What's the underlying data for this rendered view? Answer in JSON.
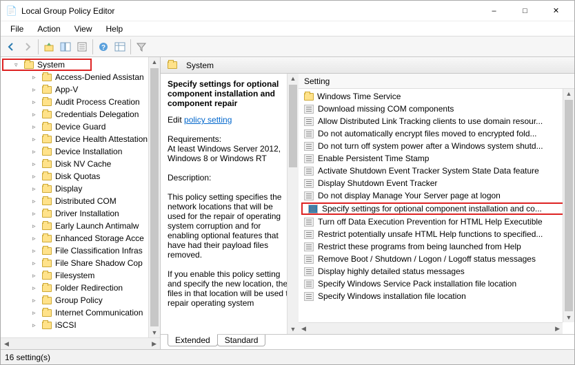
{
  "window": {
    "title": "Local Group Policy Editor"
  },
  "menu": {
    "file": "File",
    "action": "Action",
    "view": "View",
    "help": "Help"
  },
  "tree": {
    "root": "System",
    "items": [
      "Access-Denied Assistan",
      "App-V",
      "Audit Process Creation",
      "Credentials Delegation",
      "Device Guard",
      "Device Health Attestation",
      "Device Installation",
      "Disk NV Cache",
      "Disk Quotas",
      "Display",
      "Distributed COM",
      "Driver Installation",
      "Early Launch Antimalw",
      "Enhanced Storage Acce",
      "File Classification Infras",
      "File Share Shadow Cop",
      "Filesystem",
      "Folder Redirection",
      "Group Policy",
      "Internet Communication",
      "iSCSI"
    ]
  },
  "right": {
    "header": "System",
    "desc": {
      "title": "Specify settings for optional component installation and component repair",
      "edit_label": "Edit",
      "edit_link": "policy setting",
      "req_label": "Requirements:",
      "req_text": "At least Windows Server 2012, Windows 8 or Windows RT",
      "desc_label": "Description:",
      "desc_p1": "This policy setting specifies the network locations that will be used for the repair of operating system corruption and for enabling optional features that have had their payload files removed.",
      "desc_p2": "If you enable this policy setting and specify the new location, the files in that location will be used to repair operating system"
    },
    "list_header": "Setting",
    "settings": [
      {
        "type": "folder",
        "label": "Windows Time Service"
      },
      {
        "type": "setting",
        "label": "Download missing COM components"
      },
      {
        "type": "setting",
        "label": "Allow Distributed Link Tracking clients to use domain resour..."
      },
      {
        "type": "setting",
        "label": "Do not automatically encrypt files moved to encrypted fold..."
      },
      {
        "type": "setting",
        "label": "Do not turn off system power after a Windows system shutd..."
      },
      {
        "type": "setting",
        "label": "Enable Persistent Time Stamp"
      },
      {
        "type": "setting",
        "label": "Activate Shutdown Event Tracker System State Data feature"
      },
      {
        "type": "setting",
        "label": "Display Shutdown Event Tracker"
      },
      {
        "type": "setting",
        "label": "Do not display Manage Your Server page at logon"
      },
      {
        "type": "setting",
        "label": "Specify settings for optional component installation and co...",
        "highlight": true
      },
      {
        "type": "setting",
        "label": "Turn off Data Execution Prevention for HTML Help Executible"
      },
      {
        "type": "setting",
        "label": "Restrict potentially unsafe HTML Help functions to specified..."
      },
      {
        "type": "setting",
        "label": "Restrict these programs from being launched from Help"
      },
      {
        "type": "setting",
        "label": "Remove Boot / Shutdown / Logon / Logoff status messages"
      },
      {
        "type": "setting",
        "label": "Display highly detailed status messages"
      },
      {
        "type": "setting",
        "label": "Specify Windows Service Pack installation file location"
      },
      {
        "type": "setting",
        "label": "Specify Windows installation file location"
      }
    ]
  },
  "tabs": {
    "extended": "Extended",
    "standard": "Standard"
  },
  "status": "16 setting(s)"
}
